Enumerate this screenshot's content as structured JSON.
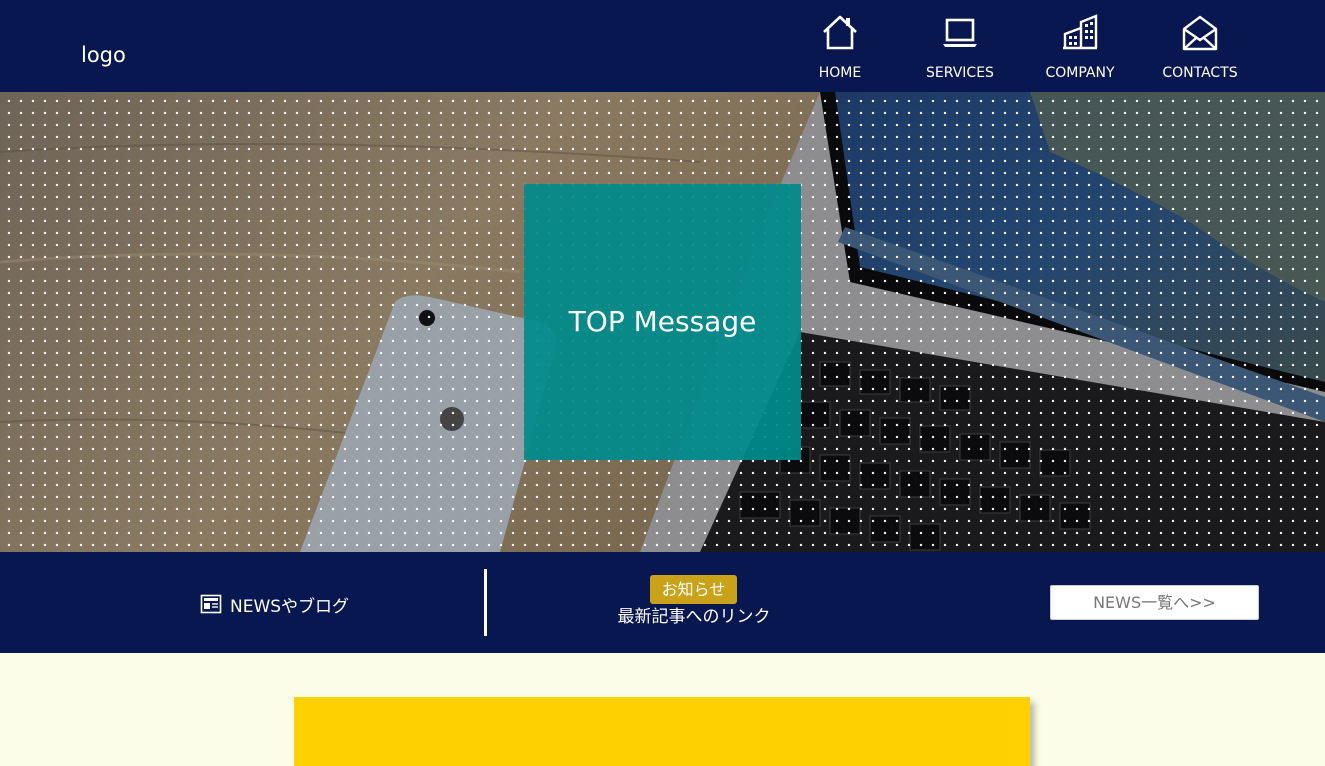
{
  "header": {
    "logo": "logo",
    "nav": [
      {
        "label": "HOME",
        "icon": "home-icon"
      },
      {
        "label": "SERVICES",
        "icon": "laptop-icon"
      },
      {
        "label": "COMPANY",
        "icon": "building-icon"
      },
      {
        "label": "CONTACTS",
        "icon": "envelope-icon"
      }
    ]
  },
  "hero": {
    "message": "TOP Message"
  },
  "news": {
    "title": "NEWSやブログ",
    "title_icon": "newspaper-icon",
    "badge": "お知らせ",
    "link_text": "最新記事へのリンク",
    "button_label": "NEWS一覧へ>>"
  },
  "colors": {
    "navy": "#08174f",
    "teal": "#008b8b",
    "gold_badge": "#c9a21a",
    "yellow": "#ffd100",
    "page_bg": "#fcfde9"
  }
}
